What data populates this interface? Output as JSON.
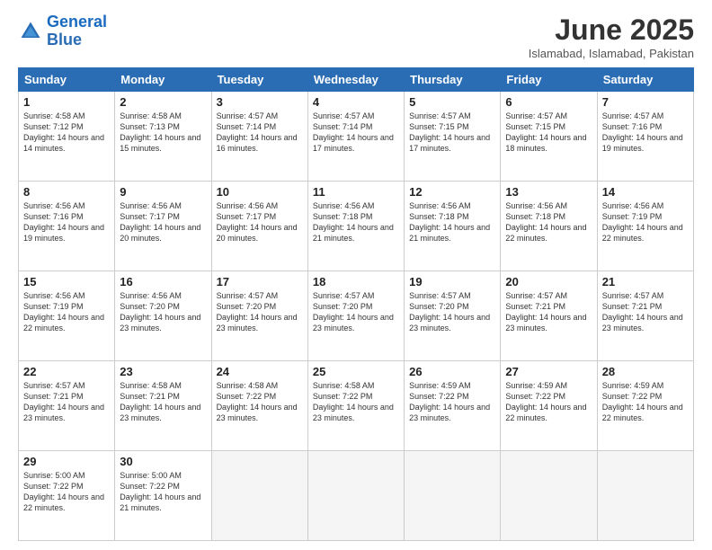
{
  "header": {
    "logo_general": "General",
    "logo_blue": "Blue",
    "month_year": "June 2025",
    "location": "Islamabad, Islamabad, Pakistan"
  },
  "weekdays": [
    "Sunday",
    "Monday",
    "Tuesday",
    "Wednesday",
    "Thursday",
    "Friday",
    "Saturday"
  ],
  "weeks": [
    [
      {
        "day": "1",
        "sunrise": "4:58 AM",
        "sunset": "7:12 PM",
        "daylight": "14 hours and 14 minutes."
      },
      {
        "day": "2",
        "sunrise": "4:58 AM",
        "sunset": "7:13 PM",
        "daylight": "14 hours and 15 minutes."
      },
      {
        "day": "3",
        "sunrise": "4:57 AM",
        "sunset": "7:14 PM",
        "daylight": "14 hours and 16 minutes."
      },
      {
        "day": "4",
        "sunrise": "4:57 AM",
        "sunset": "7:14 PM",
        "daylight": "14 hours and 17 minutes."
      },
      {
        "day": "5",
        "sunrise": "4:57 AM",
        "sunset": "7:15 PM",
        "daylight": "14 hours and 17 minutes."
      },
      {
        "day": "6",
        "sunrise": "4:57 AM",
        "sunset": "7:15 PM",
        "daylight": "14 hours and 18 minutes."
      },
      {
        "day": "7",
        "sunrise": "4:57 AM",
        "sunset": "7:16 PM",
        "daylight": "14 hours and 19 minutes."
      }
    ],
    [
      {
        "day": "8",
        "sunrise": "4:56 AM",
        "sunset": "7:16 PM",
        "daylight": "14 hours and 19 minutes."
      },
      {
        "day": "9",
        "sunrise": "4:56 AM",
        "sunset": "7:17 PM",
        "daylight": "14 hours and 20 minutes."
      },
      {
        "day": "10",
        "sunrise": "4:56 AM",
        "sunset": "7:17 PM",
        "daylight": "14 hours and 20 minutes."
      },
      {
        "day": "11",
        "sunrise": "4:56 AM",
        "sunset": "7:18 PM",
        "daylight": "14 hours and 21 minutes."
      },
      {
        "day": "12",
        "sunrise": "4:56 AM",
        "sunset": "7:18 PM",
        "daylight": "14 hours and 21 minutes."
      },
      {
        "day": "13",
        "sunrise": "4:56 AM",
        "sunset": "7:18 PM",
        "daylight": "14 hours and 22 minutes."
      },
      {
        "day": "14",
        "sunrise": "4:56 AM",
        "sunset": "7:19 PM",
        "daylight": "14 hours and 22 minutes."
      }
    ],
    [
      {
        "day": "15",
        "sunrise": "4:56 AM",
        "sunset": "7:19 PM",
        "daylight": "14 hours and 22 minutes."
      },
      {
        "day": "16",
        "sunrise": "4:56 AM",
        "sunset": "7:20 PM",
        "daylight": "14 hours and 23 minutes."
      },
      {
        "day": "17",
        "sunrise": "4:57 AM",
        "sunset": "7:20 PM",
        "daylight": "14 hours and 23 minutes."
      },
      {
        "day": "18",
        "sunrise": "4:57 AM",
        "sunset": "7:20 PM",
        "daylight": "14 hours and 23 minutes."
      },
      {
        "day": "19",
        "sunrise": "4:57 AM",
        "sunset": "7:20 PM",
        "daylight": "14 hours and 23 minutes."
      },
      {
        "day": "20",
        "sunrise": "4:57 AM",
        "sunset": "7:21 PM",
        "daylight": "14 hours and 23 minutes."
      },
      {
        "day": "21",
        "sunrise": "4:57 AM",
        "sunset": "7:21 PM",
        "daylight": "14 hours and 23 minutes."
      }
    ],
    [
      {
        "day": "22",
        "sunrise": "4:57 AM",
        "sunset": "7:21 PM",
        "daylight": "14 hours and 23 minutes."
      },
      {
        "day": "23",
        "sunrise": "4:58 AM",
        "sunset": "7:21 PM",
        "daylight": "14 hours and 23 minutes."
      },
      {
        "day": "24",
        "sunrise": "4:58 AM",
        "sunset": "7:22 PM",
        "daylight": "14 hours and 23 minutes."
      },
      {
        "day": "25",
        "sunrise": "4:58 AM",
        "sunset": "7:22 PM",
        "daylight": "14 hours and 23 minutes."
      },
      {
        "day": "26",
        "sunrise": "4:59 AM",
        "sunset": "7:22 PM",
        "daylight": "14 hours and 23 minutes."
      },
      {
        "day": "27",
        "sunrise": "4:59 AM",
        "sunset": "7:22 PM",
        "daylight": "14 hours and 22 minutes."
      },
      {
        "day": "28",
        "sunrise": "4:59 AM",
        "sunset": "7:22 PM",
        "daylight": "14 hours and 22 minutes."
      }
    ],
    [
      {
        "day": "29",
        "sunrise": "5:00 AM",
        "sunset": "7:22 PM",
        "daylight": "14 hours and 22 minutes."
      },
      {
        "day": "30",
        "sunrise": "5:00 AM",
        "sunset": "7:22 PM",
        "daylight": "14 hours and 21 minutes."
      },
      null,
      null,
      null,
      null,
      null
    ]
  ]
}
